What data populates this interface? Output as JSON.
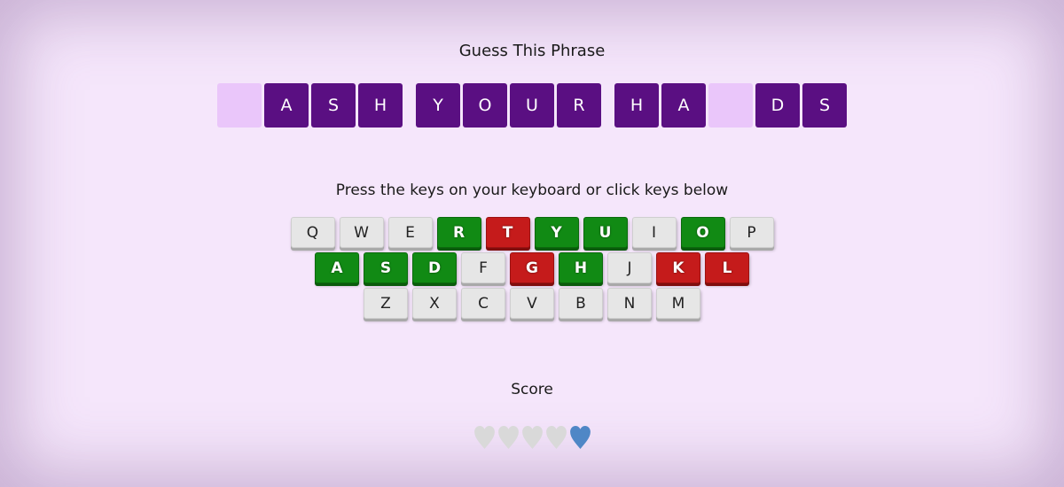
{
  "title": "Guess This Phrase",
  "phrase": [
    [
      {
        "letter": "",
        "revealed": false
      },
      {
        "letter": "A",
        "revealed": true
      },
      {
        "letter": "S",
        "revealed": true
      },
      {
        "letter": "H",
        "revealed": true
      }
    ],
    [
      {
        "letter": "Y",
        "revealed": true
      },
      {
        "letter": "O",
        "revealed": true
      },
      {
        "letter": "U",
        "revealed": true
      },
      {
        "letter": "R",
        "revealed": true
      }
    ],
    [
      {
        "letter": "H",
        "revealed": true
      },
      {
        "letter": "A",
        "revealed": true
      },
      {
        "letter": "",
        "revealed": false
      },
      {
        "letter": "D",
        "revealed": true
      },
      {
        "letter": "S",
        "revealed": true
      }
    ]
  ],
  "instructions": "Press the keys on your keyboard or click keys below",
  "keyboard": [
    [
      {
        "key": "Q",
        "state": "unused"
      },
      {
        "key": "W",
        "state": "unused"
      },
      {
        "key": "E",
        "state": "unused"
      },
      {
        "key": "R",
        "state": "correct"
      },
      {
        "key": "T",
        "state": "wrong"
      },
      {
        "key": "Y",
        "state": "correct"
      },
      {
        "key": "U",
        "state": "correct"
      },
      {
        "key": "I",
        "state": "unused"
      },
      {
        "key": "O",
        "state": "correct"
      },
      {
        "key": "P",
        "state": "unused"
      }
    ],
    [
      {
        "key": "A",
        "state": "correct"
      },
      {
        "key": "S",
        "state": "correct"
      },
      {
        "key": "D",
        "state": "correct"
      },
      {
        "key": "F",
        "state": "unused"
      },
      {
        "key": "G",
        "state": "wrong"
      },
      {
        "key": "H",
        "state": "correct"
      },
      {
        "key": "J",
        "state": "unused"
      },
      {
        "key": "K",
        "state": "wrong"
      },
      {
        "key": "L",
        "state": "wrong"
      }
    ],
    [
      {
        "key": "Z",
        "state": "unused"
      },
      {
        "key": "X",
        "state": "unused"
      },
      {
        "key": "C",
        "state": "unused"
      },
      {
        "key": "V",
        "state": "unused"
      },
      {
        "key": "B",
        "state": "unused"
      },
      {
        "key": "N",
        "state": "unused"
      },
      {
        "key": "M",
        "state": "unused"
      }
    ]
  ],
  "score": {
    "label": "Score",
    "hearts_total": 5,
    "hearts_remaining": 1,
    "lost_color": "#d9d9d9",
    "remaining_color": "#4f87c6"
  },
  "colors": {
    "background": "#f5e6fb",
    "tile_revealed": "#5a0f82",
    "tile_hidden": "#eac6fa",
    "key_correct": "#118a14",
    "key_wrong": "#c51b1b",
    "key_unused": "#e6e6e6"
  },
  "icons": {
    "heart": "heart-icon"
  }
}
